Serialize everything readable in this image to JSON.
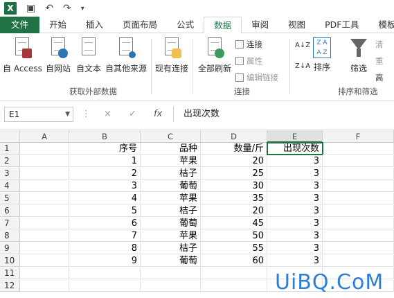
{
  "qat": {
    "excel_icon": "X",
    "save_icon": "save-icon",
    "undo_icon": "undo-icon",
    "redo_icon": "redo-icon"
  },
  "tabs": [
    "文件",
    "开始",
    "插入",
    "页面布局",
    "公式",
    "数据",
    "审阅",
    "视图",
    "PDF工具",
    "模板"
  ],
  "ribbon": {
    "external": {
      "access": "自 Access",
      "web": "自网站",
      "text": "自文本",
      "other": "自其他来源",
      "group": "获取外部数据"
    },
    "existing": "现有连接",
    "refresh": "全部刷新",
    "conn": {
      "connections": "连接",
      "properties": "属性",
      "edit_links": "编辑链接",
      "group": "连接"
    },
    "sort": {
      "sort": "排序",
      "filter": "筛选",
      "group": "排序和筛选",
      "clear": "清",
      "reapply": "重",
      "advanced": "高"
    }
  },
  "formula": {
    "cell": "E1",
    "cancel": "×",
    "enter": "✓",
    "fx": "fx",
    "value": "出现次数"
  },
  "grid": {
    "columns": [
      "A",
      "B",
      "C",
      "D",
      "E",
      "F"
    ],
    "rows": [
      "1",
      "2",
      "3",
      "4",
      "5",
      "6",
      "7",
      "8",
      "9",
      "10",
      "11",
      "12"
    ],
    "header": [
      "序号",
      "品种",
      "数量/斤",
      "出现次数"
    ],
    "data": [
      [
        "1",
        "苹果",
        "20",
        "3"
      ],
      [
        "2",
        "桔子",
        "25",
        "3"
      ],
      [
        "3",
        "葡萄",
        "30",
        "3"
      ],
      [
        "4",
        "苹果",
        "35",
        "3"
      ],
      [
        "5",
        "桔子",
        "20",
        "3"
      ],
      [
        "6",
        "葡萄",
        "45",
        "3"
      ],
      [
        "7",
        "苹果",
        "50",
        "3"
      ],
      [
        "8",
        "桔子",
        "55",
        "3"
      ],
      [
        "9",
        "葡萄",
        "60",
        "3"
      ]
    ]
  },
  "watermark": "UiBQ.CoM",
  "colors": {
    "accent": "#217346",
    "watermark": "#2a7fd4"
  }
}
